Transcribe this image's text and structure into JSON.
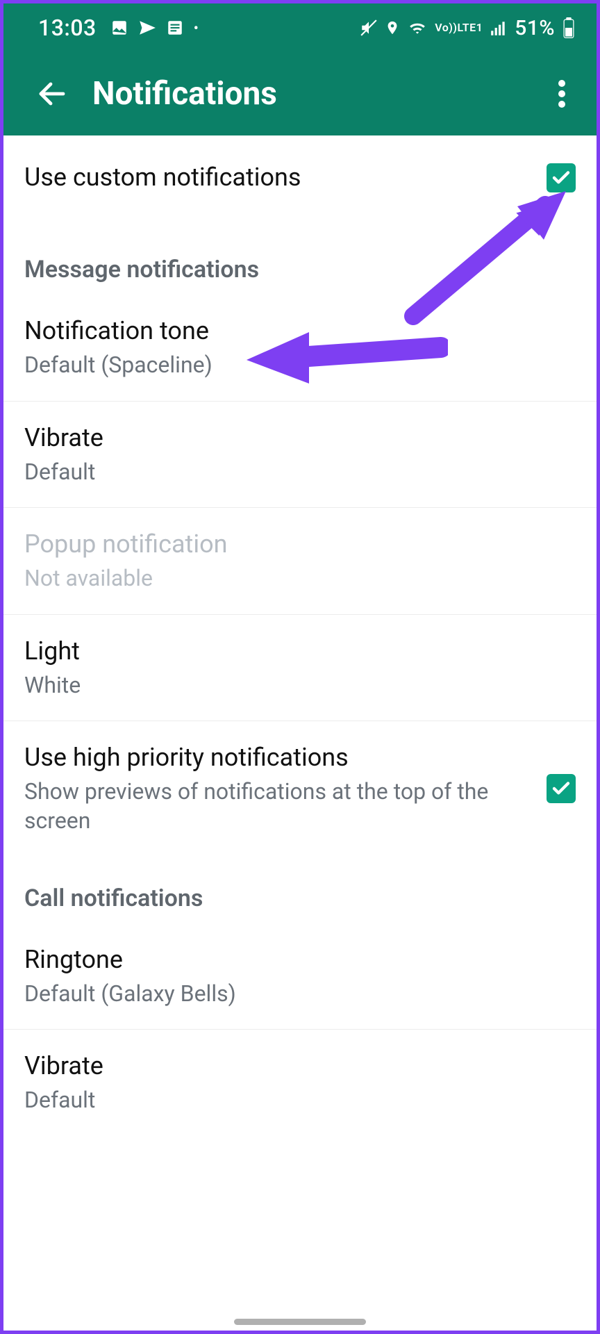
{
  "status": {
    "time": "13:03",
    "battery": "51%",
    "lte": "LTE1",
    "vo": "Vo))"
  },
  "page": {
    "title": "Notifications"
  },
  "custom": {
    "label": "Use custom notifications"
  },
  "sections": {
    "message": "Message notifications",
    "call": "Call notifications"
  },
  "message": {
    "tone": {
      "title": "Notification tone",
      "sub": "Default (Spaceline)"
    },
    "vibrate": {
      "title": "Vibrate",
      "sub": "Default"
    },
    "popup": {
      "title": "Popup notification",
      "sub": "Not available"
    },
    "light": {
      "title": "Light",
      "sub": "White"
    },
    "priority": {
      "title": "Use high priority notifications",
      "sub": "Show previews of notifications at the top of the screen"
    }
  },
  "call": {
    "ringtone": {
      "title": "Ringtone",
      "sub": "Default (Galaxy Bells)"
    },
    "vibrate": {
      "title": "Vibrate",
      "sub": "Default"
    }
  }
}
